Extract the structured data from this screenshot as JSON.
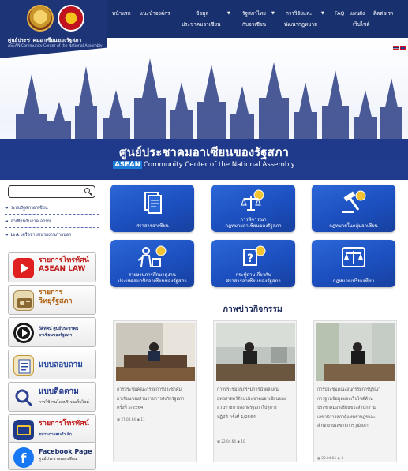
{
  "header": {
    "site_name_th": "ศูนย์ประชาคมอาเซียนของรัฐสภา",
    "site_name_en": "ASEAN Community Center of the National Assembly",
    "nav": [
      {
        "label": "หน้าแรก"
      },
      {
        "label": "แนะนำองค์กร"
      },
      {
        "label": "ข้อมูล",
        "label2": "ประชาคมอาเซียน",
        "has_dropdown": true
      },
      {
        "label": "รัฐสภาไทย",
        "label2": "กับอาเซียน",
        "has_dropdown": true
      },
      {
        "label": "การวิจัยและ",
        "label2": "พัฒนากฎหมาย",
        "has_dropdown": true
      },
      {
        "label": "FAQ"
      },
      {
        "label": "แผนผัง",
        "label2": "เว็บไซต์"
      },
      {
        "label": "ติดต่อเรา"
      }
    ]
  },
  "hero": {
    "title_th": "ศูนย์ประชาคมอาเซียนของรัฐสภา",
    "subtitle_asean": "ASEAN",
    "subtitle_rest": "Community Center of the National Assembly"
  },
  "sidebar": {
    "search_placeholder": "",
    "links": [
      {
        "label": "ระบบรัฐสภาอาเซียน"
      },
      {
        "label": "อาเซียนกับภาคเอกชน"
      },
      {
        "label": "Link เครือข่ายหน่วยงานภายนอก"
      }
    ],
    "banners": [
      {
        "title": "รายการโทรทัศน์",
        "title2": "ASEAN LAW",
        "icon": "youtube-icon"
      },
      {
        "title": "รายการ",
        "title2": "วิทยุรัฐสภา",
        "icon": "radio-icon"
      },
      {
        "title": "วีดิทัศน์ ศูนย์ประชาคม",
        "title2": "อาเซียนของรัฐสภา",
        "icon": "play-icon"
      },
      {
        "title": "แบบสอบถาม",
        "icon": "survey-icon"
      },
      {
        "title": "แบบติดตาม",
        "sub": "การใช้งานโดยบริเวณเว็บไซต์",
        "icon": "magnifier-icon"
      },
      {
        "title": "รายการโทรทัศน์",
        "sub": "ขบวนการคนตัวเล็ก",
        "icon": "tv-icon"
      },
      {
        "title": "Facebook Page",
        "sub": "ศูนย์ประชาคมอาเซียน",
        "icon": "facebook-icon"
      }
    ]
  },
  "tiles": [
    {
      "label": "ศราสารอาเซียน",
      "icon": "documents-icon"
    },
    {
      "label": "การพิจารณา",
      "label2": "กฎหมายอาเซียนของรัฐสภา",
      "icon": "scales-asean-icon"
    },
    {
      "label": "กฎหมายในกลุ่มอาเซียน",
      "icon": "gavel-icon"
    },
    {
      "label": "รายงานการศึกษาดูงาน",
      "label2": "ประเทศสมาชิกอาเซียนของรัฐสภา",
      "icon": "travel-icon"
    },
    {
      "label": "กระทู้ถามเกี่ยวกับ",
      "label2": "ศราสารอาเซียนของรัฐสภา",
      "icon": "question-icon"
    },
    {
      "label": "กฎหมายเปรียบเทียบ",
      "icon": "balance-icon"
    }
  ],
  "news": {
    "section_title": "ภาพข่าวกิจกรรม",
    "items": [
      {
        "lines": [
          "การประชุมคณะกรรมการประชาคม",
          "อาเซียนของส่วนราชการสังกัดรัฐสภา",
          "ครั้งที่ 5/2564"
        ],
        "date": "27.04.64",
        "views": "11"
      },
      {
        "lines": [
          "การประชุมอนุกรรมการนำผลแผน",
          "ยุทธศาสตร์ด้านประชาคมอาเซียนของ",
          "ส่วนราชการสังกัดรัฐสภาไปสู่การ",
          "ปฏิบัติ ครั้งที่ 1/2564"
        ],
        "date": "22.04.64",
        "views": "10"
      },
      {
        "lines": [
          "การประชุมคณะอนุกรรมการบูรณา",
          "การฐานข้อมูลและเว็บไซต์ด้าน",
          "ประชาคมอาเซียนของสำนักงาน",
          "เลขาธิการสภาผู้แทนราษฎรและ",
          "สำนักงานเลขาธิการวุฒิสภา"
        ],
        "date": "20.04.64",
        "views": "4"
      }
    ]
  },
  "colors": {
    "header_bg": "#18306e",
    "tile_blue": "#1c4fbf",
    "band_blue": "#1f3a8a"
  }
}
